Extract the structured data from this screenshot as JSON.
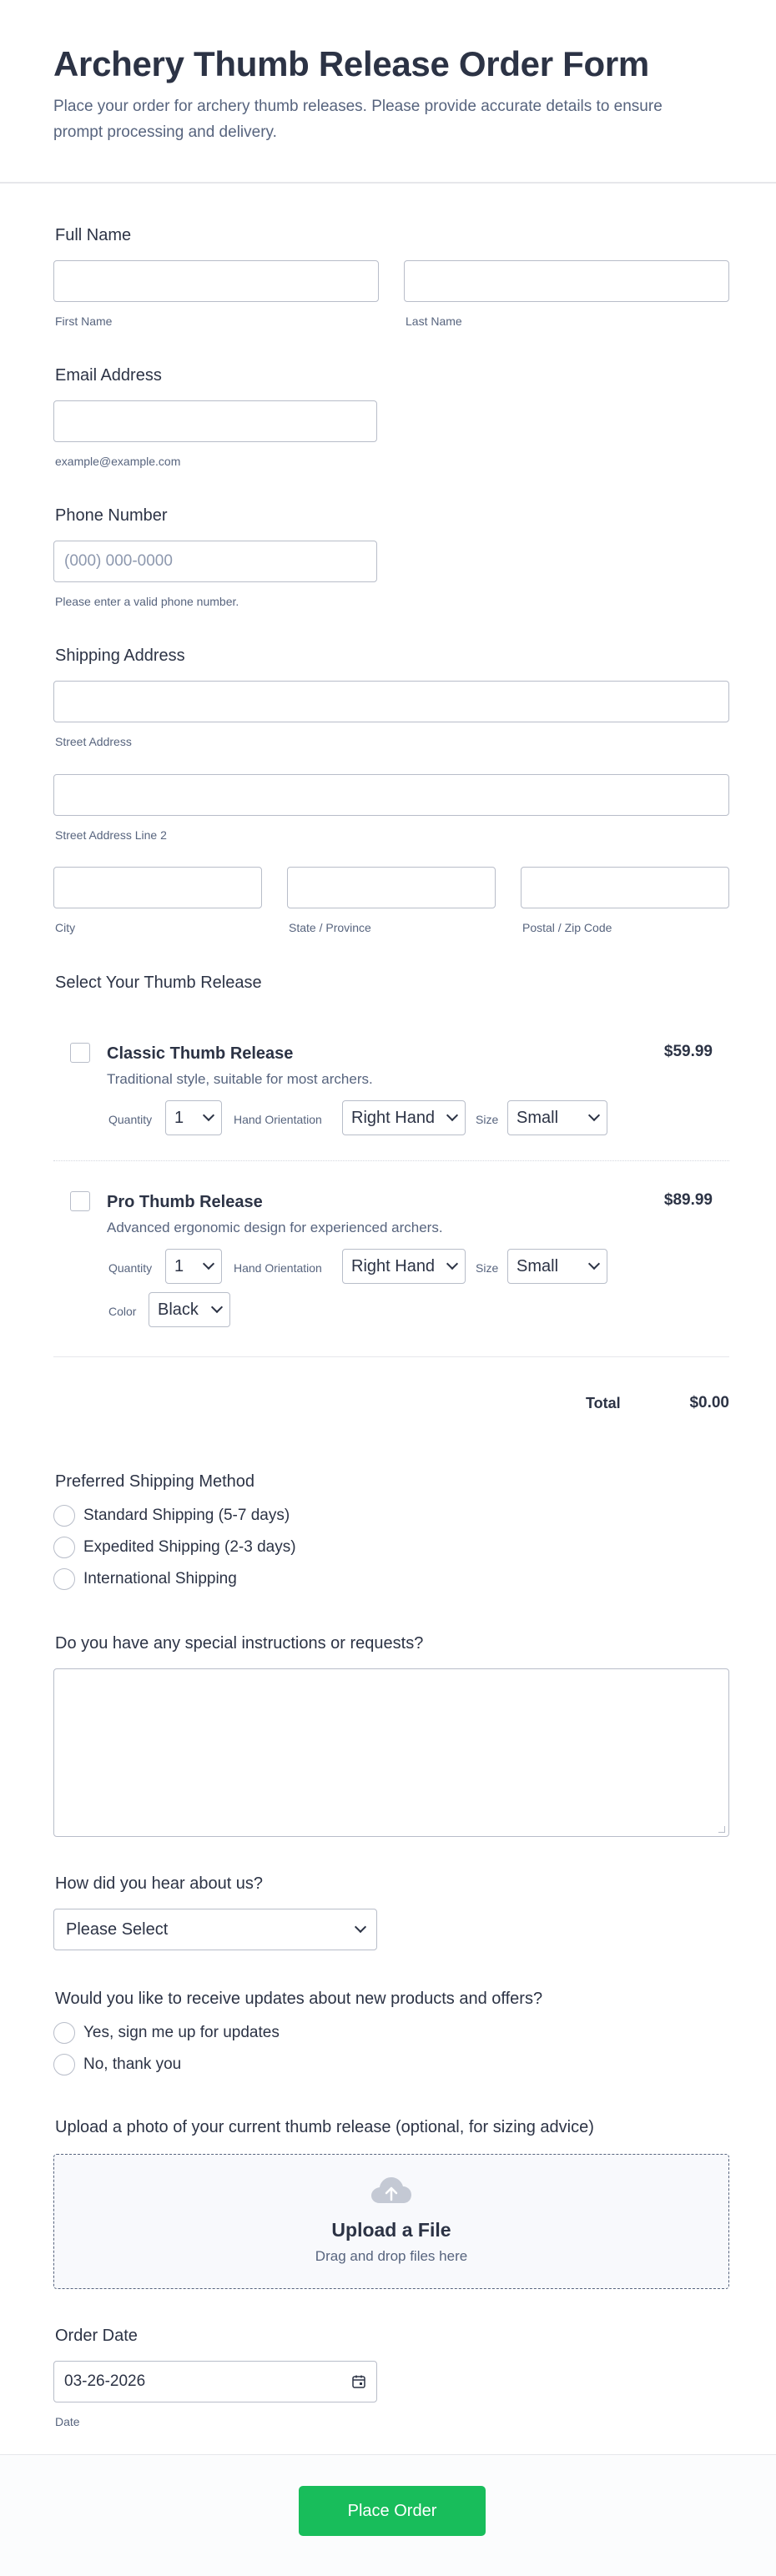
{
  "header": {
    "title": "Archery Thumb Release Order Form",
    "description": "Place your order for archery thumb releases. Please provide accurate details to ensure prompt processing and delivery."
  },
  "full_name": {
    "label": "Full Name",
    "first_sub": "First Name",
    "last_sub": "Last Name"
  },
  "email": {
    "label": "Email Address",
    "sub": "example@example.com"
  },
  "phone": {
    "label": "Phone Number",
    "placeholder": "(000) 000-0000",
    "sub": "Please enter a valid phone number."
  },
  "address": {
    "label": "Shipping Address",
    "street_sub": "Street Address",
    "street2_sub": "Street Address Line 2",
    "city_sub": "City",
    "state_sub": "State / Province",
    "zip_sub": "Postal / Zip Code"
  },
  "products": {
    "label": "Select Your Thumb Release",
    "items": [
      {
        "name": "Classic Thumb Release",
        "description": "Traditional style, suitable for most archers.",
        "price": "$59.99",
        "quantity_label": "Quantity",
        "quantity": "1",
        "orientation_label": "Hand Orientation",
        "orientation": "Right Hand",
        "size_label": "Size",
        "size": "Small"
      },
      {
        "name": "Pro Thumb Release",
        "description": "Advanced ergonomic design for experienced archers.",
        "price": "$89.99",
        "quantity_label": "Quantity",
        "quantity": "1",
        "orientation_label": "Hand Orientation",
        "orientation": "Right Hand",
        "size_label": "Size",
        "size": "Small",
        "color_label": "Color",
        "color": "Black"
      }
    ],
    "total_label": "Total",
    "total_value": "$0.00"
  },
  "shipping_method": {
    "label": "Preferred Shipping Method",
    "options": [
      "Standard Shipping (5-7 days)",
      "Expedited Shipping (2-3 days)",
      "International Shipping"
    ]
  },
  "instructions": {
    "label": "Do you have any special instructions or requests?"
  },
  "referral": {
    "label": "How did you hear about us?",
    "selected": "Please Select"
  },
  "updates": {
    "label": "Would you like to receive updates about new products and offers?",
    "options": [
      "Yes, sign me up for updates",
      "No, thank you"
    ]
  },
  "upload": {
    "label": "Upload a photo of your current thumb release (optional, for sizing advice)",
    "title": "Upload a File",
    "subtitle": "Drag and drop files here",
    "icon": "cloud-upload-icon"
  },
  "order_date": {
    "label": "Order Date",
    "value": "03-26-2026",
    "sub": "Date",
    "icon": "calendar-icon"
  },
  "submit": {
    "label": "Place Order"
  },
  "colors": {
    "submit_bg": "#18bd5b",
    "text": "#2c3345",
    "muted": "#57647e",
    "border": "#b8bdc9"
  }
}
